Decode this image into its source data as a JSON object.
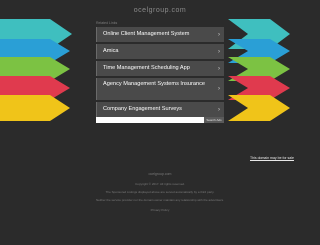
{
  "domain_title": "ocelgroup.com",
  "related_label": "Related Links",
  "links": [
    {
      "label": "Online Client Management System"
    },
    {
      "label": "Amica"
    },
    {
      "label": "Time Management Scheduling App"
    },
    {
      "label": "Agency Management Systems Insurance"
    },
    {
      "label": "Company Engagement Surveys"
    }
  ],
  "chevron": "›",
  "search": {
    "placeholder": "",
    "button_label": "Search Ads"
  },
  "for_sale_text": "This domain may be for sale",
  "footer": {
    "line1": "ocelgroup.com",
    "line2": "Copyright © 2017. All rights reserved.",
    "line3": "The Sponsored Listings displayed above are served automatically by a third party.",
    "line4": "Neither the service provider nor the domain owner maintain any relationship with the advertisers.",
    "privacy_label": "Privacy Policy"
  },
  "colors": {
    "background": "#2b2b2b",
    "arrow_colors": [
      "#3fbfbf",
      "#2a9fd6",
      "#7cc243",
      "#e03a4e",
      "#f0c419"
    ]
  }
}
